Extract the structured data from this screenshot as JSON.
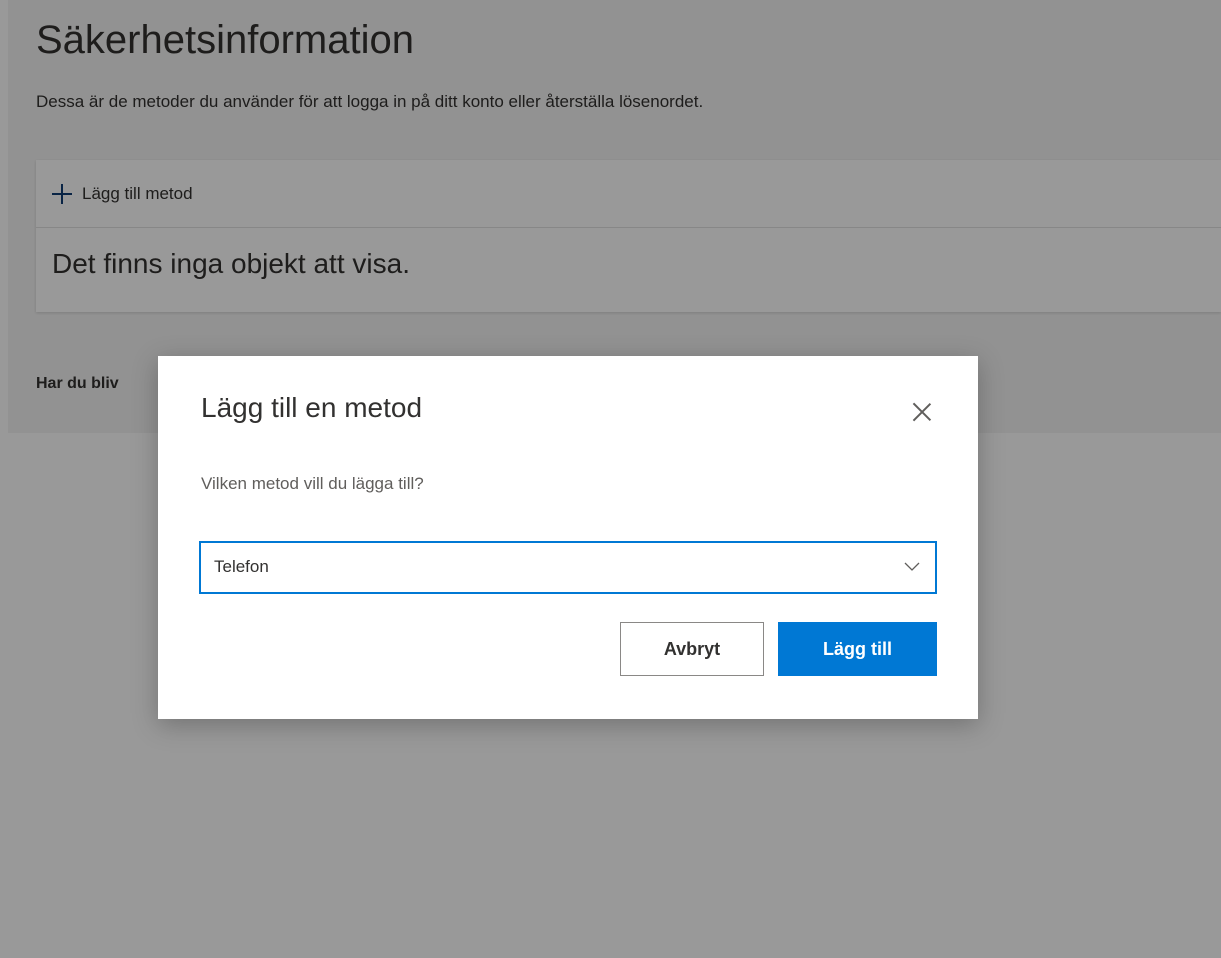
{
  "page": {
    "title": "Säkerhetsinformation",
    "subtitle": "Dessa är de metoder du använder för att logga in på ditt konto eller återställa lösenordet.",
    "add_method_label": "Lägg till metod",
    "empty_text": "Det finns inga objekt att visa.",
    "compromised_text_visible": "Har du bliv"
  },
  "dialog": {
    "title": "Lägg till en metod",
    "question": "Vilken metod vill du lägga till?",
    "selected_method": "Telefon",
    "cancel_label": "Avbryt",
    "add_label": "Lägg till"
  },
  "icons": {
    "add": "plus-icon",
    "close": "close-icon",
    "dropdown": "chevron-down-icon"
  },
  "colors": {
    "accent": "#0078d4",
    "text": "#323130",
    "muted_text": "#605e5c",
    "overlay": "rgba(0,0,0,0.4)"
  }
}
